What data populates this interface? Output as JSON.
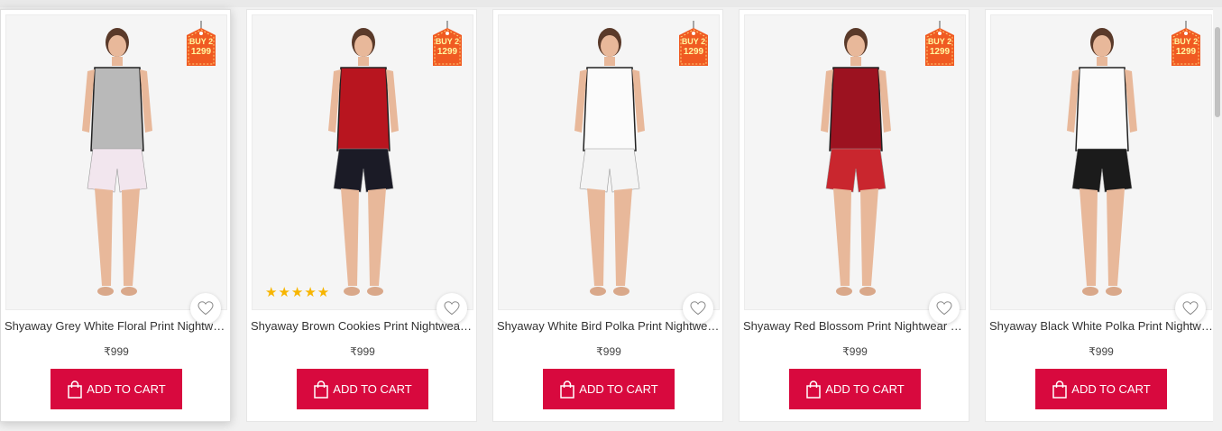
{
  "offer": {
    "line1": "BUY 2",
    "line2": "1299"
  },
  "cart_label": "ADD TO CART",
  "icons": {
    "wishlist": "heart-outline-icon",
    "cart": "shopping-bag-icon",
    "rating": "star-icon"
  },
  "colors": {
    "cart_button": "#d8093e",
    "offer_tag": "#f05a22",
    "stars": "#f7b500"
  },
  "products": [
    {
      "name": "Shyaway Grey White Floral Print Nightwe…",
      "price": "₹999",
      "rating_stars": "",
      "top": "#b9b9b9",
      "bottom": "#f2e6ee"
    },
    {
      "name": "Shyaway Brown Cookies Print Nightwear …",
      "price": "₹999",
      "rating_stars": "★★★★★",
      "top": "#b8151f",
      "bottom": "#1b1b26"
    },
    {
      "name": "Shyaway White Bird Polka Print Nightwea…",
      "price": "₹999",
      "rating_stars": "",
      "top": "#fbfbfb",
      "bottom": "#f4f4f4"
    },
    {
      "name": "Shyaway Red Blossom Print Nightwear S…",
      "price": "₹999",
      "rating_stars": "",
      "top": "#9c1220",
      "bottom": "#c9262e"
    },
    {
      "name": "Shyaway Black White Polka Print Nightw…",
      "price": "₹999",
      "rating_stars": "",
      "top": "#fbfbfb",
      "bottom": "#1b1b1b"
    }
  ]
}
